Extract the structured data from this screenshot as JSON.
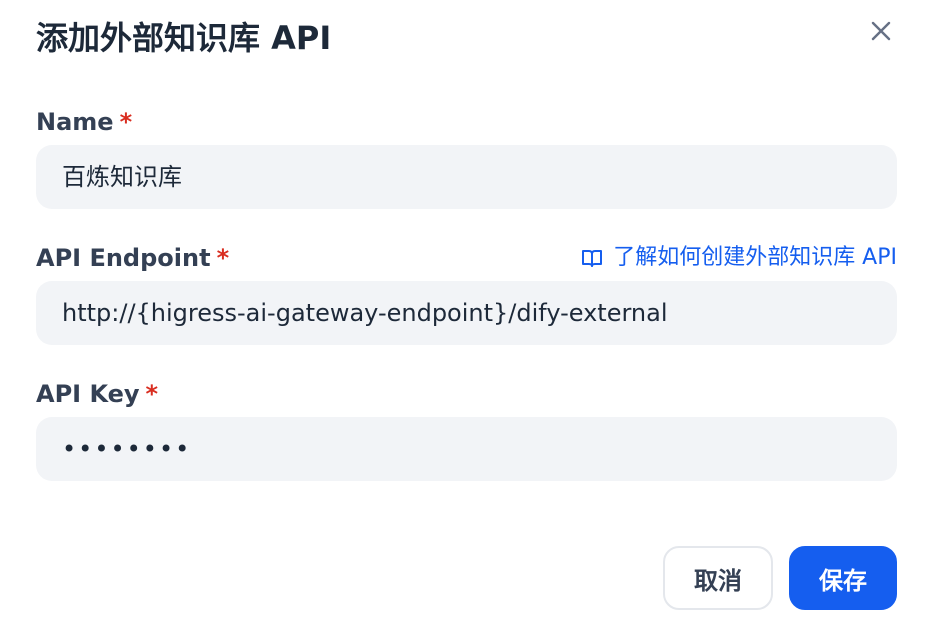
{
  "dialog": {
    "title": "添加外部知识库 API",
    "close_icon": "close-icon"
  },
  "form": {
    "name": {
      "label": "Name",
      "required_mark": "*",
      "value": "百炼知识库"
    },
    "endpoint": {
      "label": "API Endpoint",
      "required_mark": "*",
      "value": "http://{higress-ai-gateway-endpoint}/dify-external",
      "doc_link_label": "了解如何创建外部知识库 API",
      "doc_link_icon": "book-icon"
    },
    "api_key": {
      "label": "API Key",
      "required_mark": "*",
      "masked_value": "••••••••"
    }
  },
  "footer": {
    "cancel_label": "取消",
    "save_label": "保存"
  },
  "colors": {
    "primary": "#155eef",
    "required": "#d92d20",
    "input_bg": "#f2f4f7"
  }
}
